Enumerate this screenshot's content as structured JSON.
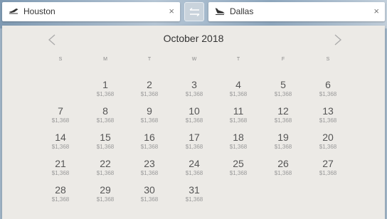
{
  "search": {
    "origin": "Houston",
    "destination": "Dallas",
    "clear_glyph": "×",
    "origin_icon": "plane-takeoff-icon",
    "destination_icon": "plane-landing-icon",
    "swap_icon": "swap-arrows-icon"
  },
  "calendar": {
    "month_label": "October 2018",
    "prev_icon": "chevron-left-icon",
    "next_icon": "chevron-right-icon",
    "weekdays": [
      "S",
      "M",
      "T",
      "W",
      "T",
      "F",
      "S"
    ],
    "first_weekday_index": 1,
    "days": [
      {
        "day": "1",
        "price": "$1,368"
      },
      {
        "day": "2",
        "price": "$1,368"
      },
      {
        "day": "3",
        "price": "$1,368"
      },
      {
        "day": "4",
        "price": "$1,368"
      },
      {
        "day": "5",
        "price": "$1,368"
      },
      {
        "day": "6",
        "price": "$1,368"
      },
      {
        "day": "7",
        "price": "$1,368"
      },
      {
        "day": "8",
        "price": "$1,368"
      },
      {
        "day": "9",
        "price": "$1,368"
      },
      {
        "day": "10",
        "price": "$1,368"
      },
      {
        "day": "11",
        "price": "$1,368"
      },
      {
        "day": "12",
        "price": "$1,368"
      },
      {
        "day": "13",
        "price": "$1,368"
      },
      {
        "day": "14",
        "price": "$1,368"
      },
      {
        "day": "15",
        "price": "$1,368"
      },
      {
        "day": "16",
        "price": "$1,368"
      },
      {
        "day": "17",
        "price": "$1,368"
      },
      {
        "day": "18",
        "price": "$1,368"
      },
      {
        "day": "19",
        "price": "$1,368"
      },
      {
        "day": "20",
        "price": "$1,368"
      },
      {
        "day": "21",
        "price": "$1,368"
      },
      {
        "day": "22",
        "price": "$1,368"
      },
      {
        "day": "23",
        "price": "$1,368"
      },
      {
        "day": "24",
        "price": "$1,368"
      },
      {
        "day": "25",
        "price": "$1,368"
      },
      {
        "day": "26",
        "price": "$1,368"
      },
      {
        "day": "27",
        "price": "$1,368"
      },
      {
        "day": "28",
        "price": "$1,368"
      },
      {
        "day": "29",
        "price": "$1,368"
      },
      {
        "day": "30",
        "price": "$1,368"
      },
      {
        "day": "31",
        "price": "$1,368"
      }
    ]
  }
}
